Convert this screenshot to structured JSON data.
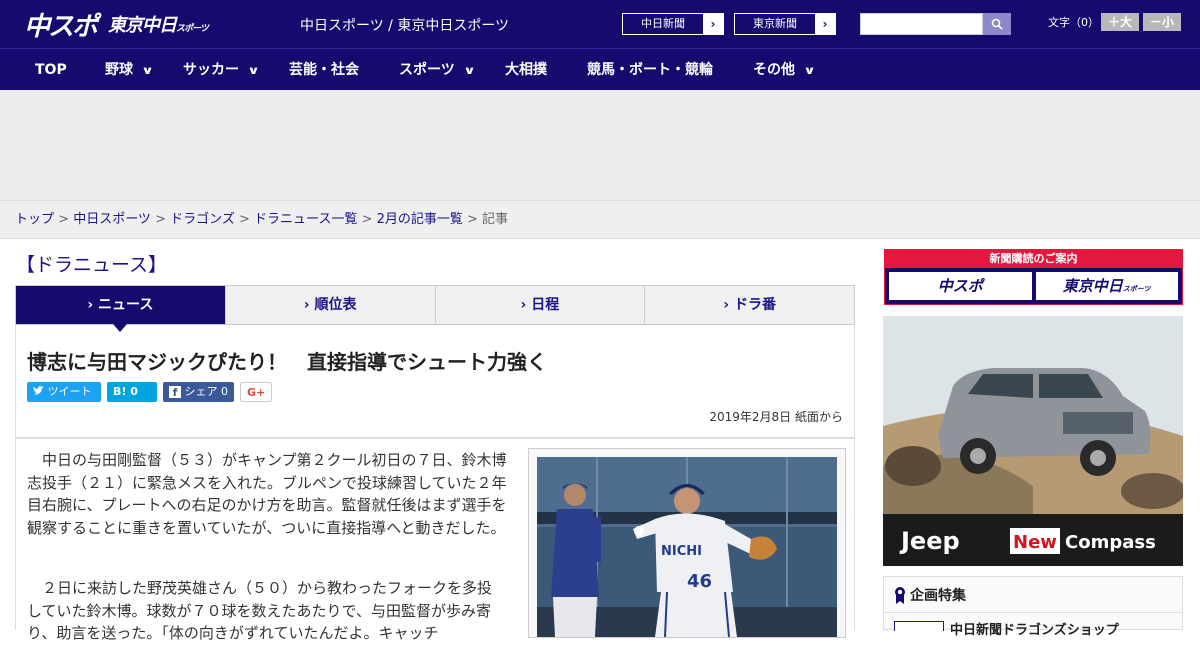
{
  "header": {
    "logo_main": "中スポ",
    "logo_sub": "東京中日",
    "logo_sub_small": "スポーツ",
    "site_links": "中日スポーツ / 東京中日スポーツ",
    "pill_chunichi": "中日新聞",
    "pill_tokyo": "東京新聞",
    "pill_arrow": "›",
    "font_label": "文字（0）",
    "font_bigger": "＋大",
    "font_smaller": "－小"
  },
  "nav": {
    "top": "TOP",
    "baseball": "野球",
    "soccer": "サッカー",
    "entertainment": "芸能・社会",
    "sports": "スポーツ",
    "sumo": "大相撲",
    "racing": "競馬・ボート・競輪",
    "other": "その他",
    "chevron": "∨"
  },
  "breadcrumb": {
    "items": [
      "トップ",
      "中日スポーツ",
      "ドラゴンズ",
      "ドラニュース一覧",
      "2月の記事一覧"
    ],
    "current": "記事",
    "sep": " > "
  },
  "section_title": "【ドラニュース】",
  "tabs": {
    "news": "ニュース",
    "standings": "順位表",
    "schedule": "日程",
    "reporter": "ドラ番"
  },
  "tab_arrow": "›",
  "article": {
    "headline": "博志に与田マジックぴたり！　直接指導でシュート力強く",
    "share_tweet": "ツイート",
    "share_hatena_count": "0",
    "share_fb": "シェア 0",
    "share_gplus": "G+",
    "date": "2019年2月8日 紙面から",
    "para1": "中日の与田剛監督（５３）がキャンプ第２クール初日の７日、鈴木博志投手（２１）に緊急メスを入れた。ブルペンで投球練習していた２年目右腕に、プレートへの右足のかけ方を助言。監督就任後はまず選手を観察することに重きを置いていたが、ついに直接指導へと動きだした。",
    "para2": "２日に来訪した野茂英雄さん（５０）から教わったフォークを多投していた鈴木博。球数が７０球を数えたあたりで、与田監督が歩み寄り、助言を送った。「体の向きがずれていたんだよ。キャッチ"
  },
  "photo": {
    "jersey_text": "NICHI",
    "number": "46"
  },
  "sidebar": {
    "banner_title": "新聞購読のご案内",
    "logo1": "中スポ",
    "logo2": "東京中日",
    "logo2_small": "スポーツ",
    "ad_brand": "Jeep",
    "ad_new": "New",
    "ad_model": "Compass",
    "special_title": "企画特集",
    "special_item": "中日新聞ドラゴンズショップ"
  },
  "colors": {
    "brand_navy": "#150b6e",
    "accent_red": "#e5173f",
    "twitter": "#1da1f2",
    "hatena": "#00a4de",
    "facebook": "#3b5998"
  }
}
